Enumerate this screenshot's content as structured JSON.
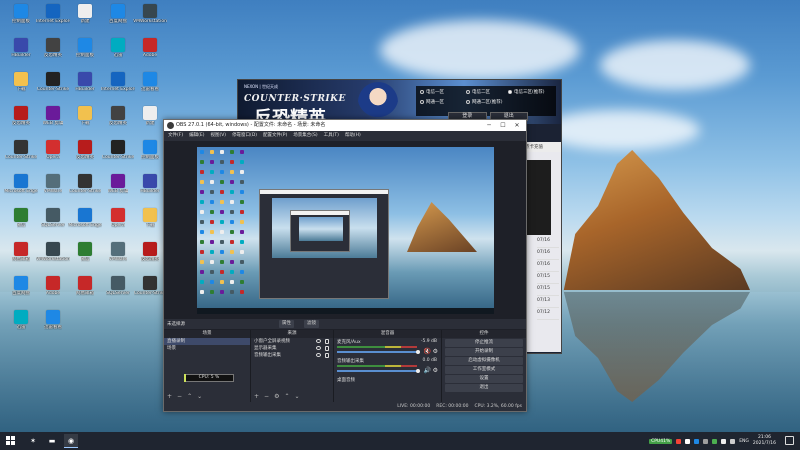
{
  "desktop_icons": [
    {
      "label": "控制面板",
      "icon": "control-panel-icon",
      "color": "#1e88e5"
    },
    {
      "label": "HBuilder",
      "icon": "hbuilder-icon",
      "color": "#3949ab"
    },
    {
      "label": "下载",
      "icon": "folder-icon",
      "color": "#f2c14e"
    },
    {
      "label": "反恐精英",
      "icon": "cs-icon",
      "color": "#b71c1c"
    },
    {
      "label": "Counter-Strike",
      "icon": "cs-icon",
      "color": "#333333"
    },
    {
      "label": "Microsoft Edge",
      "icon": "edge-icon",
      "color": "#1976d2"
    },
    {
      "label": "微信",
      "icon": "wechat-icon",
      "color": "#2e7d32"
    },
    {
      "label": "网易邮箱",
      "icon": "mail-icon",
      "color": "#c62828"
    },
    {
      "label": "百度网盘",
      "icon": "cloud-icon",
      "color": "#1e88e5"
    },
    {
      "label": "迅雷",
      "icon": "thunder-icon",
      "color": "#00acc1"
    },
    {
      "label": "Internet Explorer",
      "icon": "ie-icon",
      "color": "#1565c0"
    },
    {
      "label": "反恐精英",
      "icon": "cs-icon",
      "color": "#424242"
    },
    {
      "label": "Counter-Strike",
      "icon": "obs-icon",
      "color": "#222222"
    },
    {
      "label": "WEB 剪辑",
      "icon": "video-icon",
      "color": "#6a1b9a"
    },
    {
      "label": "Opera",
      "icon": "opera-icon",
      "color": "#d32f2f"
    },
    {
      "label": "VMWare",
      "icon": "vm-icon",
      "color": "#546e7a"
    },
    {
      "label": "SQLServer",
      "icon": "sql-icon",
      "color": "#455a64"
    },
    {
      "label": "VMWorkstation",
      "icon": "vm-icon",
      "color": "#37474f"
    },
    {
      "label": "Adobe",
      "icon": "adobe-icon",
      "color": "#c62828"
    },
    {
      "label": "迅雷看看",
      "icon": "player-icon",
      "color": "#1e88e5"
    },
    {
      "label": "新建",
      "icon": "doc-icon",
      "color": "#eeeeee"
    }
  ],
  "game": {
    "logo": "NEXON | 世纪天成",
    "title": "COUNTER·STRIKE",
    "subtitle": "反恐精英",
    "servers": [
      "电信一区",
      "电信二区",
      "电信三区(推荐)",
      "网通一区",
      "网通二区(推荐)"
    ],
    "buttons": [
      "登录",
      "退出"
    ],
    "side_header": "点卡充值",
    "dates": [
      "07/16",
      "07/16",
      "07/16",
      "07/15",
      "07/15",
      "07/13",
      "07/12"
    ]
  },
  "obs": {
    "title": "OBS 27.0.1 (64-bit, windows) - 配置文件: 未命名 - 场景: 未命名",
    "menu": [
      "文件(F)",
      "编辑(E)",
      "视图(V)",
      "停靠窗口(D)",
      "配置文件(P)",
      "场景集合(S)",
      "工具(T)",
      "帮助(H)"
    ],
    "scene_bar": {
      "label": "未选择源",
      "props": "属性",
      "filters": "滤镜"
    },
    "docks": {
      "scenes": {
        "header": "场景",
        "items": [
          "直播录制",
          "场景"
        ]
      },
      "sources": {
        "header": "来源",
        "items": [
          "小窗户全屏录视频",
          "显示器采集",
          "音频输出采集"
        ]
      },
      "mixer": {
        "header": "混音器",
        "channels": [
          {
            "name": "麦克风/Aux",
            "level": "-5.9 dB"
          },
          {
            "name": "音频输出采集",
            "level": "0.0 dB"
          },
          {
            "name": "桌面音频",
            "level": ""
          }
        ]
      },
      "controls": {
        "header": "控件",
        "buttons": [
          "停止推流",
          "开始录制",
          "启动虚拟摄像机",
          "工作室模式",
          "设置",
          "退出"
        ]
      }
    },
    "cpu_tooltip": "CPU: 5 %",
    "status": [
      "LIVE: 00:00:00",
      "REC: 00:00:00",
      "CPU: 3.2%, 60.00 fps"
    ]
  },
  "taskbar": {
    "apps": [
      "cs-icon",
      "folder-icon",
      "obs-icon"
    ],
    "cpu_badge": "CPU41%",
    "lang": "ENG",
    "time": "21:06",
    "date": "2021/7/16"
  }
}
